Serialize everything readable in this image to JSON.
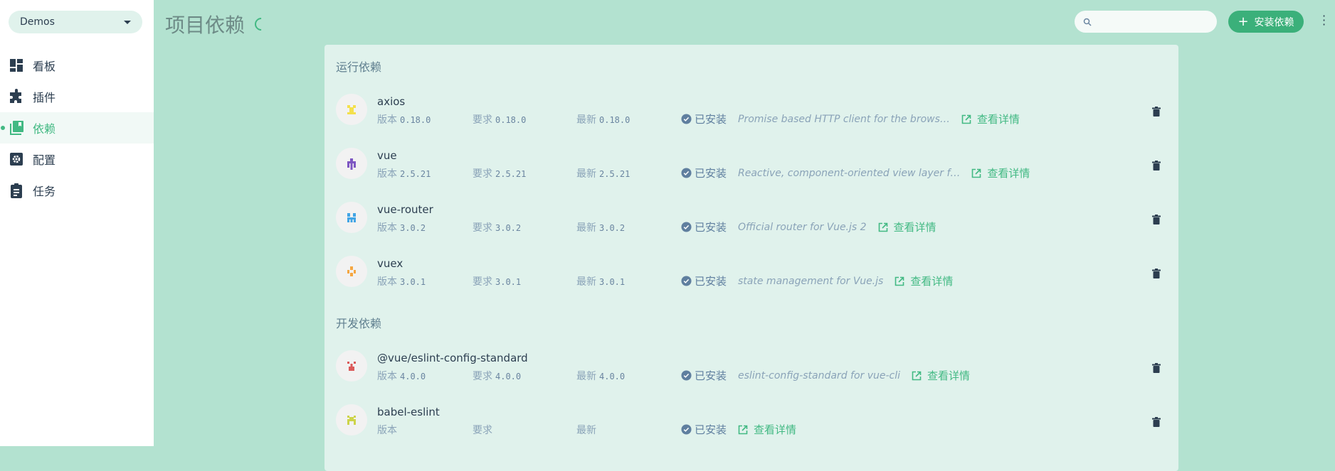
{
  "sidebar": {
    "project": "Demos",
    "items": [
      {
        "label": "看板",
        "icon": "dashboard-icon"
      },
      {
        "label": "插件",
        "icon": "puzzle-icon"
      },
      {
        "label": "依赖",
        "icon": "library-books-icon",
        "active": true
      },
      {
        "label": "配置",
        "icon": "settings-icon"
      },
      {
        "label": "任务",
        "icon": "clipboard-icon"
      }
    ]
  },
  "header": {
    "title": "项目依赖",
    "search_placeholder": "",
    "install_label": "安装依赖"
  },
  "labels": {
    "version": "版本",
    "required": "要求",
    "latest": "最新",
    "installed": "已安装",
    "details": "查看详情"
  },
  "sections": [
    {
      "title": "运行依赖",
      "items": [
        {
          "name": "axios",
          "version": "0.18.0",
          "required": "0.18.0",
          "latest": "0.18.0",
          "description": "Promise based HTTP client for the brows…",
          "avatar_color": "#f4e04d"
        },
        {
          "name": "vue",
          "version": "2.5.21",
          "required": "2.5.21",
          "latest": "2.5.21",
          "description": "Reactive, component-oriented view layer f…",
          "avatar_color": "#7e57c2"
        },
        {
          "name": "vue-router",
          "version": "3.0.2",
          "required": "3.0.2",
          "latest": "3.0.2",
          "description": "Official router for Vue.js 2",
          "avatar_color": "#42a5e5"
        },
        {
          "name": "vuex",
          "version": "3.0.1",
          "required": "3.0.1",
          "latest": "3.0.1",
          "description": "state management for Vue.js",
          "avatar_color": "#f5a742"
        }
      ]
    },
    {
      "title": "开发依赖",
      "items": [
        {
          "name": "@vue/eslint-config-standard",
          "version": "4.0.0",
          "required": "4.0.0",
          "latest": "4.0.0",
          "description": "eslint-config-standard for vue-cli",
          "avatar_color": "#db5a5a"
        },
        {
          "name": "babel-eslint",
          "version": "",
          "required": "",
          "latest": "",
          "description": "",
          "avatar_color": "#cdd44a"
        }
      ]
    }
  ],
  "colors": {
    "accent": "#42b983",
    "background": "#b3e2d0",
    "card": "#e0f2ec"
  }
}
